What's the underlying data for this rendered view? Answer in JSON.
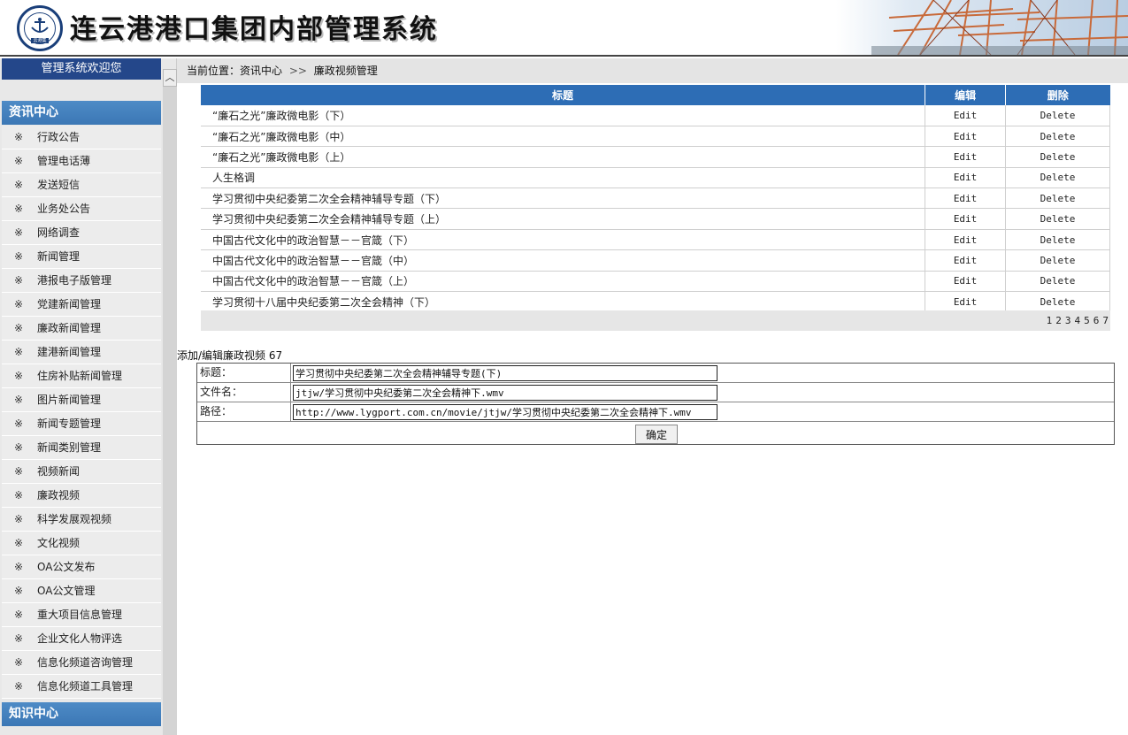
{
  "header": {
    "title": "连云港港口集团内部管理系统",
    "logo_text": "云港集"
  },
  "sidebar": {
    "welcome": "管理系统欢迎您",
    "section_news": "资讯中心",
    "section_knowledge": "知识中心",
    "bullet": "※",
    "items": [
      "行政公告",
      "管理电话薄",
      "发送短信",
      "业务处公告",
      "网络调查",
      "新闻管理",
      "港报电子版管理",
      "党建新闻管理",
      "廉政新闻管理",
      "建港新闻管理",
      "住房补贴新闻管理",
      "图片新闻管理",
      "新闻专题管理",
      "新闻类别管理",
      "视频新闻",
      "廉政视频",
      "科学发展观视频",
      "文化视频",
      "OA公文发布",
      "OA公文管理",
      "重大项目信息管理",
      "企业文化人物评选",
      "信息化频道咨询管理",
      "信息化频道工具管理"
    ]
  },
  "breadcrumb": {
    "prefix": "当前位置：资讯中心",
    "sep": ">>",
    "current": "廉政视频管理"
  },
  "table": {
    "headers": {
      "title": "标题",
      "edit": "编辑",
      "delete": "删除"
    },
    "rows": [
      {
        "title": "“廉石之光”廉政微电影（下）",
        "edit": "Edit",
        "delete": "Delete"
      },
      {
        "title": "“廉石之光”廉政微电影（中）",
        "edit": "Edit",
        "delete": "Delete"
      },
      {
        "title": "“廉石之光”廉政微电影（上）",
        "edit": "Edit",
        "delete": "Delete"
      },
      {
        "title": "人生格调",
        "edit": "Edit",
        "delete": "Delete"
      },
      {
        "title": "学习贯彻中央纪委第二次全会精神辅导专题（下）",
        "edit": "Edit",
        "delete": "Delete"
      },
      {
        "title": "学习贯彻中央纪委第二次全会精神辅导专题（上）",
        "edit": "Edit",
        "delete": "Delete"
      },
      {
        "title": "中国古代文化中的政治智慧－－官箴（下）",
        "edit": "Edit",
        "delete": "Delete"
      },
      {
        "title": "中国古代文化中的政治智慧－－官箴（中）",
        "edit": "Edit",
        "delete": "Delete"
      },
      {
        "title": "中国古代文化中的政治智慧－－官箴（上）",
        "edit": "Edit",
        "delete": "Delete"
      },
      {
        "title": "学习贯彻十八届中央纪委第二次全会精神（下）",
        "edit": "Edit",
        "delete": "Delete"
      }
    ],
    "pages": [
      "1",
      "2",
      "3",
      "4",
      "5",
      "6",
      "7"
    ]
  },
  "form": {
    "caption": "添加/编辑廉政视频 67",
    "title_label": "标题：",
    "title_value": "学习贯彻中央纪委第二次全会精神辅导专题(下)",
    "file_label": "文件名：",
    "file_value": "jtjw/学习贯彻中央纪委第二次全会精神下.wmv",
    "path_label": "路径：",
    "path_value": "http://www.lygport.com.cn/movie/jtjw/学习贯彻中央纪委第二次全会精神下.wmv",
    "submit": "确定"
  },
  "colors": {
    "header_blue": "#24478a",
    "table_header": "#2d6db5",
    "section_blue": "#3b77b5"
  }
}
